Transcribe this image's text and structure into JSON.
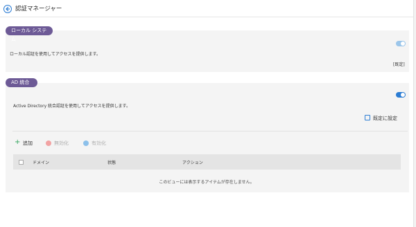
{
  "header": {
    "title": "認証マネージャー",
    "back_icon": "back-arrow-icon"
  },
  "local_system": {
    "tag": "ローカル システム",
    "description": "ローカル認証を使用してアクセスを提供します。",
    "enabled": true,
    "default_label": "[既定]"
  },
  "ad_integration": {
    "tag": "AD 統合",
    "description": "Active Directory 統合認証を使用してアクセスを提供します。",
    "enabled": true,
    "set_default_label": "既定に設定",
    "actions": {
      "add": "追加",
      "disable": "無効化",
      "enable": "有効化"
    },
    "table": {
      "columns": [
        "ドメイン",
        "状態",
        "アクション"
      ],
      "rows": [],
      "empty_message": "このビューには表示するアイテムが存在しません。"
    }
  },
  "colors": {
    "accent": "#2b7cd3",
    "tag_bg": "#6d5a96",
    "add_green": "#2ea35a",
    "disable_red": "#f2a3a3",
    "enable_blue": "#8cc0ea"
  }
}
